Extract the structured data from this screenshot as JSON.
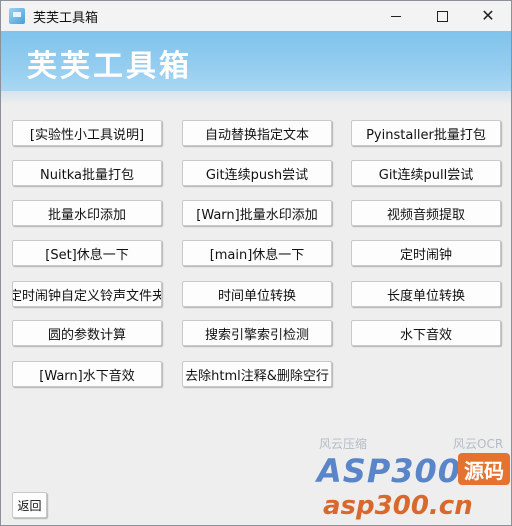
{
  "window": {
    "title": "芙芙工具箱",
    "controls": {
      "minimize": "—",
      "maximize": "□",
      "close": "✕"
    }
  },
  "banner": {
    "title": "芙芙工具箱"
  },
  "buttons": [
    "[实验性小工具说明]",
    "自动替换指定文本",
    "Pyinstaller批量打包",
    "Nuitka批量打包",
    "Git连续push尝试",
    "Git连续pull尝试",
    "批量水印添加",
    "[Warn]批量水印添加",
    "视频音频提取",
    "[Set]休息一下",
    "[main]休息一下",
    "定时闹钟",
    "定时闹钟自定义铃声文件夹",
    "时间单位转换",
    "长度单位转换",
    "圆的参数计算",
    "搜索引擎索引检测",
    "水下音效",
    "[Warn]水下音效",
    "去除html注释&删除空行"
  ],
  "back_button": {
    "label": "返回"
  },
  "watermark": {
    "logo": "ASP300",
    "badge": "源码",
    "url": "asp300.cn",
    "bg_texts": [
      "风云压缩",
      "风云OCR"
    ]
  },
  "colors": {
    "banner": "#95cdf0",
    "watermark_blue": "#5a86c9",
    "watermark_orange": "#e4732f"
  }
}
